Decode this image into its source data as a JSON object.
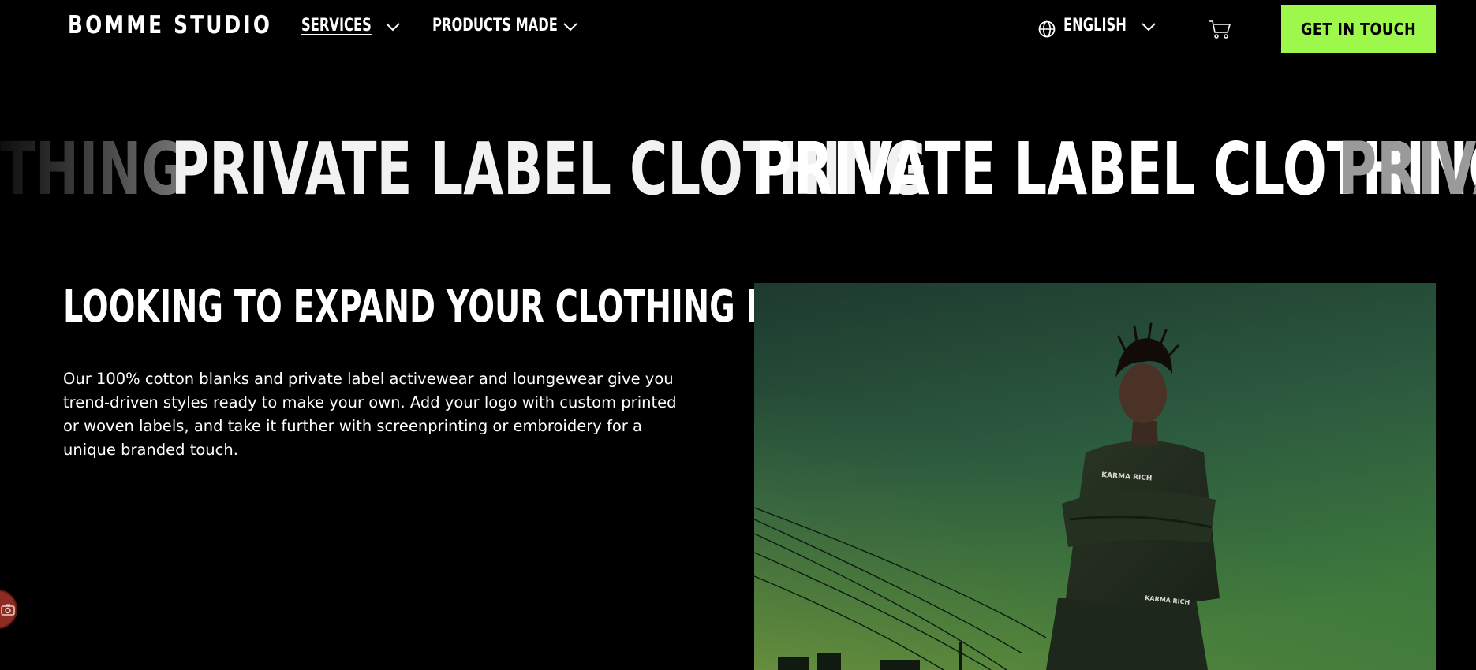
{
  "header": {
    "logo": "BOMME STUDIO",
    "nav": [
      {
        "label": "SERVICES",
        "active": true
      },
      {
        "label": "PRODUCTS MADE",
        "active": false
      }
    ],
    "language": "ENGLISH",
    "cta_label": "GET IN TOUCH",
    "icons": [
      "globe-icon",
      "chevron-down-icon",
      "cart-icon"
    ]
  },
  "marquee": {
    "partial_left": "THING",
    "items": [
      "PRIVATE LABEL CLOTHING",
      "PRIVATE LABEL CLOTHING"
    ],
    "partial_right": "PRIVAT"
  },
  "content": {
    "headline": "LOOKING TO EXPAND YOUR CLOTHING LINE?",
    "body": [
      "Our 100% cotton blanks and private label activewear and loungewear give you",
      "trend-driven styles ready to make your own. Add your logo with custom printed",
      "or woven labels, and take it further with screenprinting or embroidery for a",
      "unique branded touch."
    ]
  },
  "photo": {
    "subject": "model in dark green sweatsuit against evening sky",
    "garment_print_top": "KARMA RICH",
    "garment_print_bottom": "KARMA RICH"
  },
  "colors": {
    "background": "#000000",
    "accent": "#9ef74b",
    "text": "#ffffff",
    "widget": "#8e2b22"
  }
}
